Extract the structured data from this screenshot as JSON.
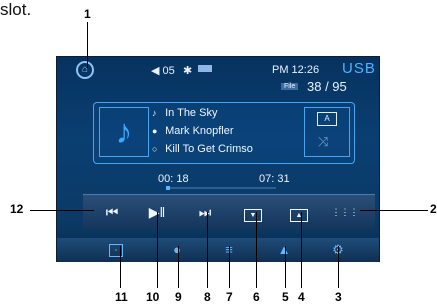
{
  "caption": "slot.",
  "status_bar": {
    "volume": "05",
    "time": "PM 12:26",
    "source": "USB",
    "file_label": "File",
    "file_counter": "38 / 95"
  },
  "track": {
    "title": "In The Sky",
    "artist": "Mark Knopfler",
    "album": "Kill To Get Crimso"
  },
  "progress": {
    "elapsed": "00: 18",
    "total": "07: 31",
    "fraction": 0.04
  },
  "controls": {
    "prev": "⏮",
    "play_pause": "▶‖",
    "next": "⏭",
    "folder_down": "▼",
    "folder_up": "▲",
    "menu": "⋮⋮⋮"
  },
  "callouts": [
    "1",
    "2",
    "3",
    "4",
    "5",
    "6",
    "7",
    "8",
    "9",
    "10",
    "11",
    "12"
  ]
}
